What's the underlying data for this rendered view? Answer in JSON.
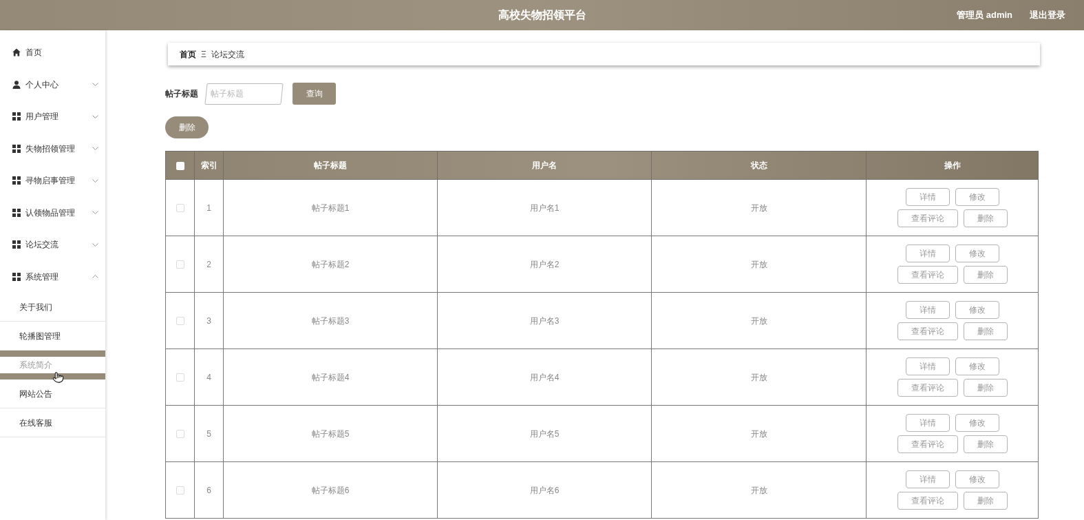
{
  "header": {
    "title": "高校失物招领平台",
    "user": "管理员 admin",
    "logout": "退出登录"
  },
  "sidebar": {
    "items": [
      {
        "label": "首页"
      },
      {
        "label": "个人中心",
        "expanded": false
      },
      {
        "label": "用户管理",
        "expanded": false
      },
      {
        "label": "失物招领管理",
        "expanded": false
      },
      {
        "label": "寻物启事管理",
        "expanded": false
      },
      {
        "label": "认领物品管理",
        "expanded": false
      },
      {
        "label": "论坛交流",
        "expanded": false
      },
      {
        "label": "系统管理",
        "expanded": true,
        "children": [
          {
            "label": "关于我们",
            "hovered": false
          },
          {
            "label": "轮播图管理",
            "hovered": false
          },
          {
            "label": "系统简介",
            "hovered": true
          },
          {
            "label": "网站公告",
            "hovered": false
          },
          {
            "label": "在线客服",
            "hovered": false
          }
        ]
      }
    ]
  },
  "breadcrumb": {
    "items": [
      "首页",
      "论坛交流"
    ],
    "separator": "Ξ"
  },
  "search": {
    "label": "帖子标题",
    "placeholder": "帖子标题",
    "button": "查询"
  },
  "delete_button": "删除",
  "table": {
    "select_all": {
      "checked": false
    },
    "columns": [
      "索引",
      "帖子标题",
      "用户名",
      "状态",
      "操作"
    ],
    "rows": [
      {
        "checked": false,
        "index": "1",
        "title": "帖子标题1",
        "user": "用户名1",
        "status": "开放",
        "actions": [
          "详情",
          "修改",
          "查看评论",
          "删除"
        ]
      },
      {
        "checked": false,
        "index": "2",
        "title": "帖子标题2",
        "user": "用户名2",
        "status": "开放",
        "actions": [
          "详情",
          "修改",
          "查看评论",
          "删除"
        ]
      },
      {
        "checked": false,
        "index": "3",
        "title": "帖子标题3",
        "user": "用户名3",
        "status": "开放",
        "actions": [
          "详情",
          "修改",
          "查看评论",
          "删除"
        ]
      },
      {
        "checked": false,
        "index": "4",
        "title": "帖子标题4",
        "user": "用户名4",
        "status": "开放",
        "actions": [
          "详情",
          "修改",
          "查看评论",
          "删除"
        ]
      },
      {
        "checked": false,
        "index": "5",
        "title": "帖子标题5",
        "user": "用户名5",
        "status": "开放",
        "actions": [
          "详情",
          "修改",
          "查看评论",
          "删除"
        ]
      },
      {
        "checked": false,
        "index": "6",
        "title": "帖子标题6",
        "user": "用户名6",
        "status": "开放",
        "actions": [
          "详情",
          "修改",
          "查看评论",
          "删除"
        ]
      }
    ]
  }
}
